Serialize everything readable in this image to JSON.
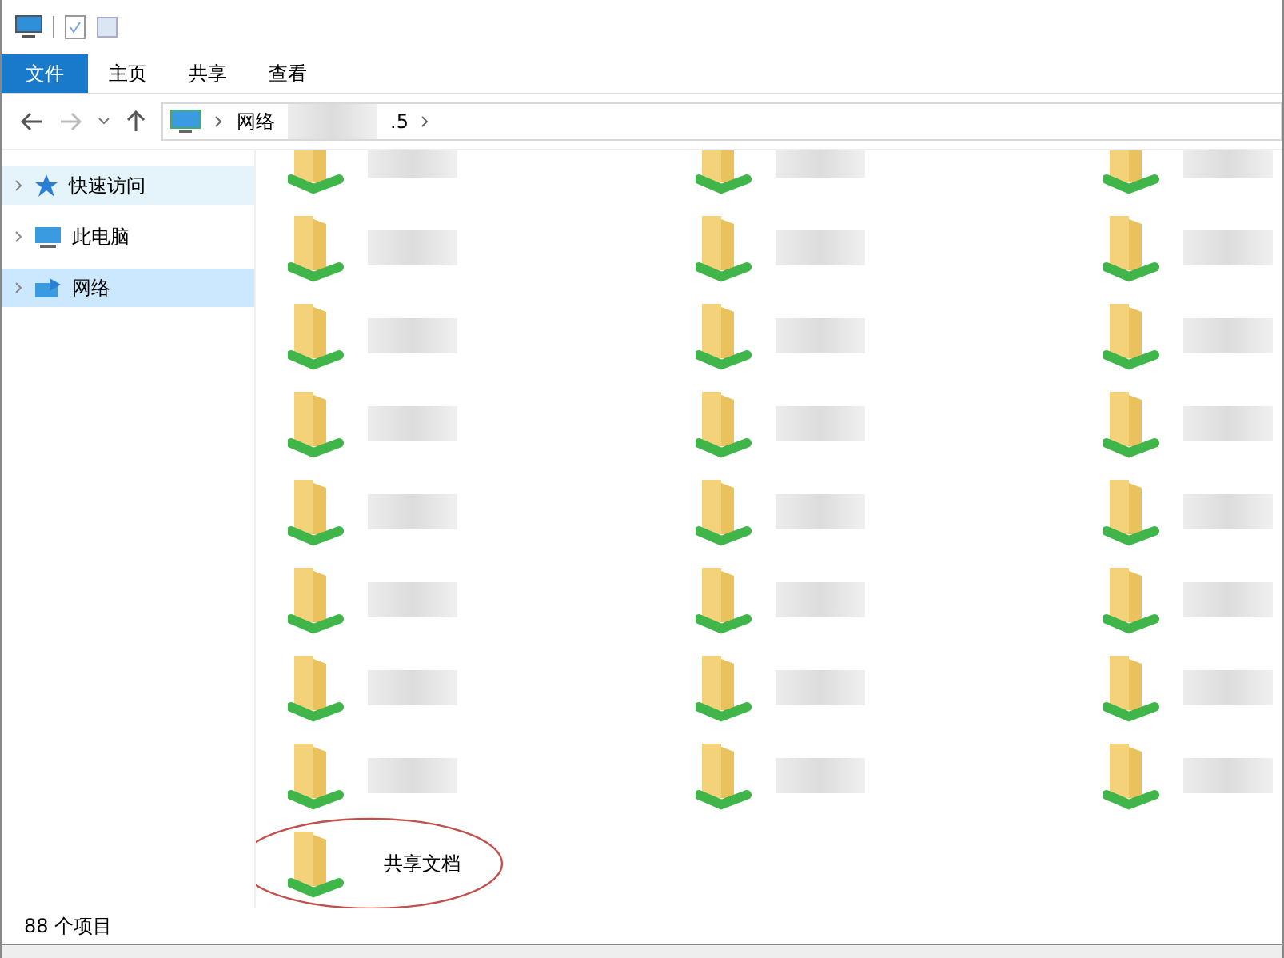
{
  "ribbon": {
    "tabs": [
      {
        "label": "文件",
        "selected": true
      },
      {
        "label": "主页",
        "selected": false
      },
      {
        "label": "共享",
        "selected": false
      },
      {
        "label": "查看",
        "selected": false
      }
    ]
  },
  "address": {
    "first": "网络",
    "last": ".5"
  },
  "sidebar": {
    "items": [
      {
        "label": "快速访问",
        "kind": "star",
        "selected": false,
        "hovered": true
      },
      {
        "label": "此电脑",
        "kind": "computer",
        "selected": false,
        "hovered": false
      },
      {
        "label": "网络",
        "kind": "network",
        "selected": true,
        "hovered": false
      }
    ]
  },
  "folders": [
    {
      "kind": "blurred"
    },
    {
      "kind": "blurred"
    },
    {
      "kind": "blurred"
    },
    {
      "kind": "blurred"
    },
    {
      "kind": "blurred"
    },
    {
      "kind": "blurred"
    },
    {
      "kind": "blurred"
    },
    {
      "kind": "blurred"
    },
    {
      "kind": "blurred"
    },
    {
      "kind": "blurred"
    },
    {
      "kind": "blurred"
    },
    {
      "kind": "blurred"
    },
    {
      "kind": "blurred"
    },
    {
      "kind": "blurred"
    },
    {
      "kind": "blurred"
    },
    {
      "kind": "blurred"
    },
    {
      "kind": "blurred"
    },
    {
      "kind": "blurred"
    },
    {
      "kind": "blurred"
    },
    {
      "kind": "blurred"
    },
    {
      "kind": "blurred"
    },
    {
      "kind": "blurred"
    },
    {
      "kind": "blurred"
    },
    {
      "kind": "blurred"
    },
    {
      "kind": "named",
      "label": "共享文档",
      "circled": true
    }
  ],
  "status_bar": {
    "count": "88 个项目"
  }
}
